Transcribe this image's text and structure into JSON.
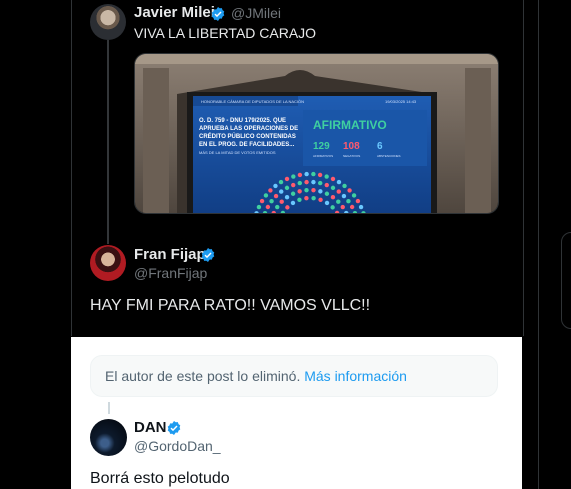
{
  "colors": {
    "verified": "#1d9bf0",
    "link": "#1d9bf0",
    "dark_bg": "#000000",
    "light_bg": "#ffffff"
  },
  "post1": {
    "name": "Javier Milei",
    "handle": "@JMilei",
    "text": "VIVA LA LIBERTAD CARAJO",
    "media": {
      "header": "HONORABLE CÁMARA DE DIPUTADOS DE LA NACIÓN",
      "date": "19/03/2025 14:43",
      "title_lines": [
        "O. D. 759 - DNU 179/2025. QUE",
        "APRUEBA LAS OPERACIONES DE",
        "CRÉDITO PÚBLICO CONTENIDAS",
        "EN EL PROG. DE FACILIDADES..."
      ],
      "majority": "MÁS DE LA MITAD DE VOTOS EMITIDOS",
      "result": "AFIRMATIVO",
      "votes": [
        {
          "value": "129",
          "label": "AFIRMATIVOS",
          "color": "#3fd0a0"
        },
        {
          "value": "108",
          "label": "NEGATIVOS",
          "color": "#ff5a6e"
        },
        {
          "value": "6",
          "label": "ABSTENCIONES",
          "color": "#6ac8ff"
        }
      ]
    }
  },
  "post2": {
    "name": "Fran Fijap",
    "handle": "@FranFijap",
    "text": "HAY FMI PARA RATO!! VAMOS VLLC!!"
  },
  "deleted_notice": {
    "text": "El autor de este post lo eliminó. ",
    "link": "Más información"
  },
  "post3": {
    "name": "DAN",
    "handle": "@GordoDan_",
    "text": "Borrá esto pelotudo"
  }
}
